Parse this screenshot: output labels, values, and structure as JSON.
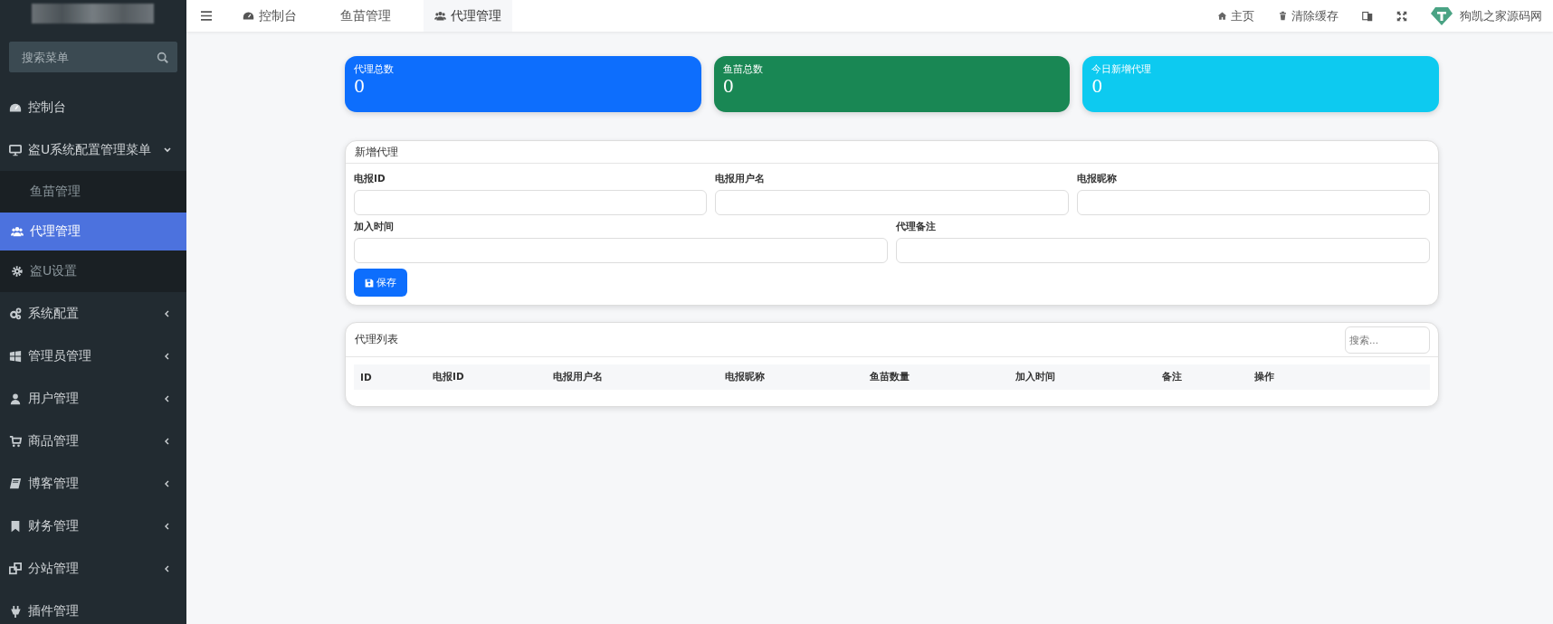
{
  "header": {
    "tabs": [
      {
        "label": "控制台",
        "selected": false
      },
      {
        "label": "鱼苗管理",
        "selected": false
      },
      {
        "label": "代理管理",
        "selected": true
      }
    ],
    "actions": [
      {
        "label": "主页"
      },
      {
        "label": "清除缓存"
      }
    ],
    "user": {
      "name": "狗凯之家源码网"
    }
  },
  "sidebar": {
    "search": {
      "placeholder": "搜索菜单"
    },
    "items": [
      {
        "label": "控制台",
        "kind": "link",
        "selected": false
      },
      {
        "label": "盗U系统配置管理菜单",
        "kind": "folder",
        "selected": false,
        "expanded": true,
        "children": [
          {
            "label": "鱼苗管理",
            "selected": false
          },
          {
            "label": "代理管理",
            "selected": true
          },
          {
            "label": "盗U设置",
            "selected": false
          }
        ]
      },
      {
        "label": "系统配置",
        "kind": "folder",
        "selected": false,
        "expanded": false
      },
      {
        "label": "管理员管理",
        "kind": "folder",
        "selected": false,
        "expanded": false
      },
      {
        "label": "用户管理",
        "kind": "folder",
        "selected": false,
        "expanded": false
      },
      {
        "label": "商品管理",
        "kind": "folder",
        "selected": false,
        "expanded": false
      },
      {
        "label": "博客管理",
        "kind": "folder",
        "selected": false,
        "expanded": false
      },
      {
        "label": "财务管理",
        "kind": "folder",
        "selected": false,
        "expanded": false
      },
      {
        "label": "分站管理",
        "kind": "folder",
        "selected": false,
        "expanded": false
      },
      {
        "label": "插件管理",
        "kind": "link",
        "selected": false
      }
    ]
  },
  "stats": [
    {
      "label": "代理总数",
      "value": "0",
      "color": "#0d6efd"
    },
    {
      "label": "鱼苗总数",
      "value": "0",
      "color": "#198754"
    },
    {
      "label": "今日新增代理",
      "value": "0",
      "color": "#0dcaf0"
    }
  ],
  "form": {
    "title": "新增代理",
    "rows": [
      [
        {
          "label": "电报ID"
        },
        {
          "label": "电报用户名"
        },
        {
          "label": "电报昵称"
        }
      ],
      [
        {
          "label": "加入时间"
        },
        {
          "label": "代理备注"
        }
      ]
    ],
    "button": "保存"
  },
  "table": {
    "title": "代理列表",
    "search": {
      "placeholder": "搜索..."
    },
    "columns": [
      "ID",
      "电报ID",
      "电报用户名",
      "电报昵称",
      "鱼苗数量",
      "加入时间",
      "备注",
      "操作"
    ]
  }
}
